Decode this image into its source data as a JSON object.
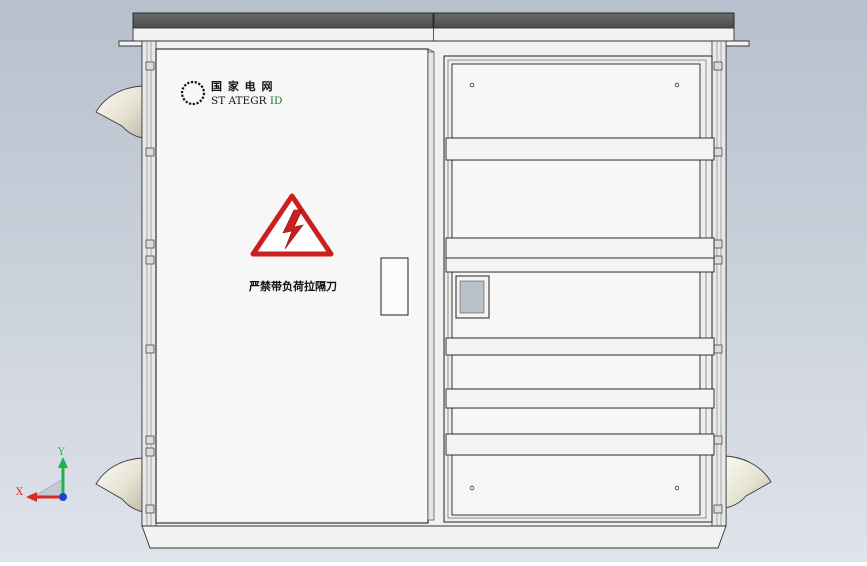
{
  "logo": {
    "name_cn": "国 家 电 网",
    "name_en_part1": "ST ATEGR",
    "name_en_part2": "ID"
  },
  "door": {
    "warning_label": "严禁带负荷拉隔刀"
  },
  "triad": {
    "x_label": "X",
    "y_label": "Y"
  },
  "colors": {
    "background_top": "#b7c0cd",
    "background_bottom": "#dfe3ea",
    "roof": "#595959",
    "hazard_red": "#cc1f1f",
    "logo_green": "#1e7a34",
    "axis_x": "#d42a2a",
    "axis_y": "#22b04a",
    "axis_z": "#1f3fd6"
  }
}
